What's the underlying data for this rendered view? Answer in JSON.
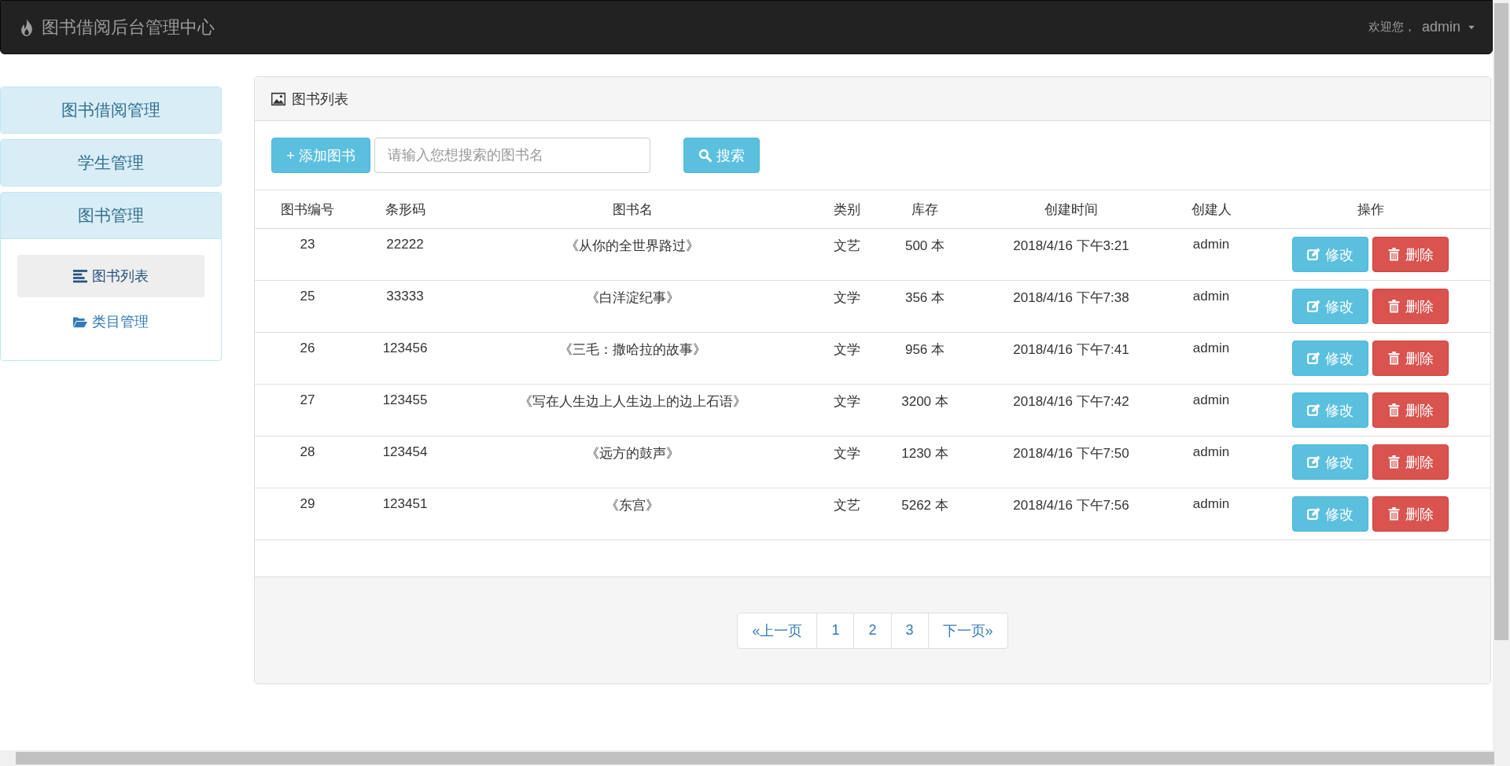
{
  "navbar": {
    "title": "图书借阅后台管理中心",
    "welcome": "欢迎您，",
    "user": "admin"
  },
  "sidebar": {
    "groups": [
      {
        "label": "图书借阅管理",
        "expanded": false
      },
      {
        "label": "学生管理",
        "expanded": false
      },
      {
        "label": "图书管理",
        "expanded": true,
        "items": [
          {
            "label": "图书列表",
            "selected": true
          },
          {
            "label": "类目管理",
            "selected": false
          }
        ]
      }
    ]
  },
  "panel": {
    "title": "图书列表",
    "toolbar": {
      "add_button": "+ 添加图书",
      "search": {
        "placeholder": "请输入您想搜索的图书名"
      },
      "search_button": "搜索"
    },
    "table": {
      "columns": [
        "图书编号",
        "条形码",
        "图书名",
        "类别",
        "库存",
        "创建时间",
        "创建人",
        "操作"
      ],
      "rows": [
        {
          "id": "23",
          "barcode": "22222",
          "name": "《从你的全世界路过》",
          "category": "文艺",
          "stock": "500 本",
          "created": "2018/4/16 下午3:21",
          "creator": "admin",
          "edit": "修改",
          "delete": "删除"
        },
        {
          "id": "25",
          "barcode": "33333",
          "name": "《白洋淀纪事》",
          "category": "文学",
          "stock": "356 本",
          "created": "2018/4/16 下午7:38",
          "creator": "admin",
          "edit": "修改",
          "delete": "删除"
        },
        {
          "id": "26",
          "barcode": "123456",
          "name": "《三毛：撒哈拉的故事》",
          "category": "文学",
          "stock": "956 本",
          "created": "2018/4/16 下午7:41",
          "creator": "admin",
          "edit": "修改",
          "delete": "删除"
        },
        {
          "id": "27",
          "barcode": "123455",
          "name": "《写在人生边上人生边上的边上石语》",
          "category": "文学",
          "stock": "3200 本",
          "created": "2018/4/16 下午7:42",
          "creator": "admin",
          "edit": "修改",
          "delete": "删除"
        },
        {
          "id": "28",
          "barcode": "123454",
          "name": "《远方的鼓声》",
          "category": "文学",
          "stock": "1230 本",
          "created": "2018/4/16 下午7:50",
          "creator": "admin",
          "edit": "修改",
          "delete": "删除"
        },
        {
          "id": "29",
          "barcode": "123451",
          "name": "《东宫》",
          "category": "文艺",
          "stock": "5262 本",
          "created": "2018/4/16 下午7:56",
          "creator": "admin",
          "edit": "修改",
          "delete": "删除"
        }
      ]
    },
    "pagination": [
      "«上一页",
      "1",
      "2",
      "3",
      "下一页»"
    ]
  }
}
